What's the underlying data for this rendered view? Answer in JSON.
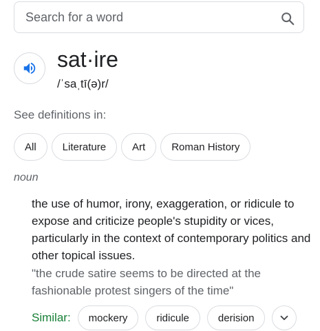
{
  "search": {
    "placeholder": "Search for a word"
  },
  "entry": {
    "word": "sat·ire",
    "phonetic": "/ˈsaˌtī(ə)r/"
  },
  "see_definitions": {
    "label": "See definitions in:",
    "chips": [
      "All",
      "Literature",
      "Art",
      "Roman History"
    ]
  },
  "sense": {
    "part_of_speech": "noun",
    "definition": "the use of humor, irony, exaggeration, or ridicule to expose and criticize people's stupidity or vices, particularly in the context of contemporary politics and other topical issues.",
    "example": "\"the crude satire seems to be directed at the fashionable protest singers of the time\""
  },
  "similar": {
    "label": "Similar:",
    "words": [
      "mockery",
      "ridicule",
      "derision"
    ]
  },
  "icons": {
    "search": "search-icon",
    "audio": "speaker-icon",
    "expand": "chevron-down-icon"
  },
  "colors": {
    "accent_blue": "#1a73e8",
    "similar_green": "#188038",
    "border": "#dadce0"
  }
}
